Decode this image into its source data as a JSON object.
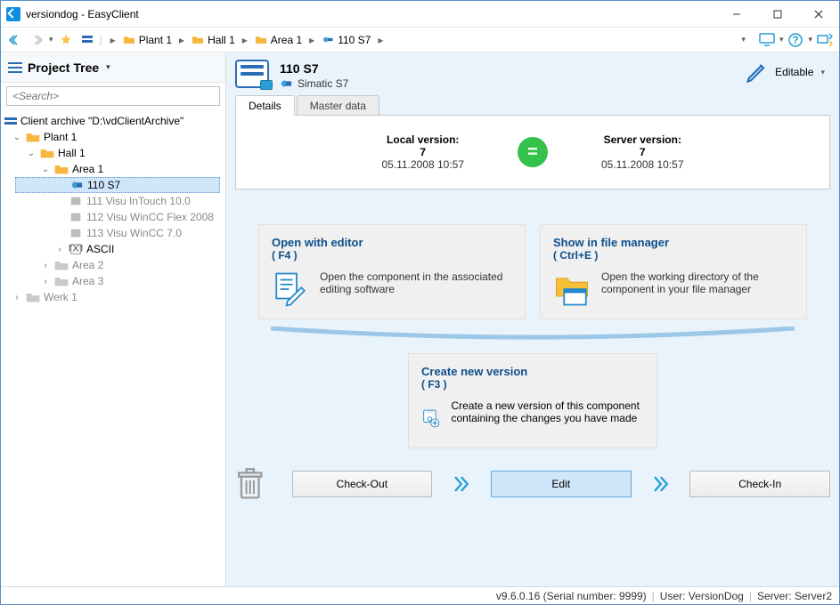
{
  "window": {
    "title": "versiondog - EasyClient"
  },
  "breadcrumbs": [
    "Plant 1",
    "Hall 1",
    "Area 1",
    "110 S7"
  ],
  "breadcrumb_icon_last": "component",
  "projectTree": {
    "title": "Project Tree",
    "searchPlaceholder": "<Search>",
    "rootLabel": "Client archive \"D:\\vdClientArchive\"",
    "nodes": {
      "plant1": "Plant 1",
      "hall1": "Hall 1",
      "area1": "Area 1",
      "n110": "110 S7",
      "n111": "111 Visu InTouch 10.0",
      "n112": "112 Visu WinCC Flex 2008",
      "n113": "113 Visu WinCC 7.0",
      "ascii": "ASCII",
      "area2": "Area 2",
      "area3": "Area 3",
      "werk1": "Werk 1"
    }
  },
  "component": {
    "name": "110 S7",
    "type": "Simatic S7",
    "editableLabel": "Editable"
  },
  "tabs": {
    "details": "Details",
    "master": "Master data"
  },
  "versions": {
    "localLabel": "Local version:",
    "localNum": "7",
    "localDate": "05.11.2008 10:57",
    "serverLabel": "Server version:",
    "serverNum": "7",
    "serverDate": "05.11.2008 10:57"
  },
  "cards": {
    "open": {
      "title": "Open with editor",
      "shortcut": "( F4 )",
      "desc": "Open the component in the associated editing software"
    },
    "show": {
      "title": "Show in file manager",
      "shortcut": "( Ctrl+E )",
      "desc": "Open the working directory of the component in your file manager"
    },
    "create": {
      "title": "Create new version",
      "shortcut": "( F3 )",
      "desc": "Create a new version of this component containing the changes you have made"
    }
  },
  "actions": {
    "checkout": "Check-Out",
    "edit": "Edit",
    "checkin": "Check-In"
  },
  "status": {
    "version": "v9.6.0.16 (Serial number: 9999)",
    "user": "User: VersionDog",
    "server": "Server: Server2"
  }
}
